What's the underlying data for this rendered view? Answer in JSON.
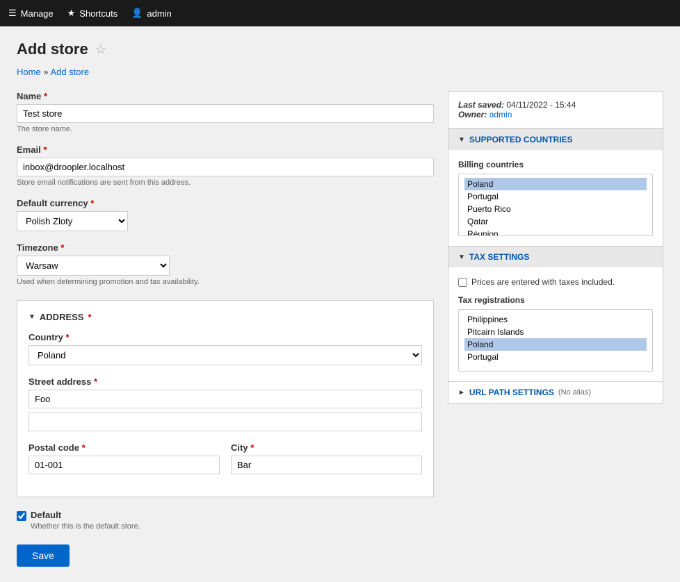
{
  "topnav": {
    "manage_label": "Manage",
    "shortcuts_label": "Shortcuts",
    "admin_label": "admin"
  },
  "page": {
    "title": "Add store",
    "breadcrumb_home": "Home",
    "breadcrumb_current": "Add store"
  },
  "sidebar": {
    "last_saved_label": "Last saved:",
    "last_saved_value": "04/11/2022 - 15:44",
    "owner_label": "Owner:",
    "owner_value": "admin"
  },
  "supported_countries": {
    "section_title": "SUPPORTED COUNTRIES",
    "billing_countries_label": "Billing countries",
    "billing_countries": [
      "Poland",
      "Portugal",
      "Puerto Rico",
      "Qatar",
      "Réunion"
    ]
  },
  "tax_settings": {
    "section_title": "TAX SETTINGS",
    "prices_taxes_label": "Prices are entered with taxes included.",
    "prices_taxes_checked": false,
    "tax_registrations_label": "Tax registrations",
    "tax_registrations": [
      "Philippines",
      "Pitcairn Islands",
      "Poland",
      "Portugal"
    ]
  },
  "url_path": {
    "section_title": "URL PATH SETTINGS",
    "no_alias_label": "(No alias)"
  },
  "form": {
    "name_label": "Name",
    "name_required": true,
    "name_value": "Test store",
    "name_hint": "The store name.",
    "email_label": "Email",
    "email_required": true,
    "email_value": "inbox@droopler.localhost",
    "email_hint": "Store email notifications are sent from this address.",
    "currency_label": "Default currency",
    "currency_required": true,
    "currency_value": "Polish Zloty",
    "timezone_label": "Timezone",
    "timezone_required": true,
    "timezone_value": "Warsaw",
    "timezone_hint": "Used when determining promotion and tax availability.",
    "address": {
      "section_title": "ADDRESS",
      "required": true,
      "country_label": "Country",
      "country_required": true,
      "country_value": "Poland",
      "street_label": "Street address",
      "street_required": true,
      "street_value_1": "Foo",
      "street_value_2": "",
      "postal_label": "Postal code",
      "postal_required": true,
      "postal_value": "01-001",
      "city_label": "City",
      "city_required": true,
      "city_value": "Bar"
    },
    "default_label": "Default",
    "default_checked": true,
    "default_hint": "Whether this is the default store.",
    "save_label": "Save"
  }
}
